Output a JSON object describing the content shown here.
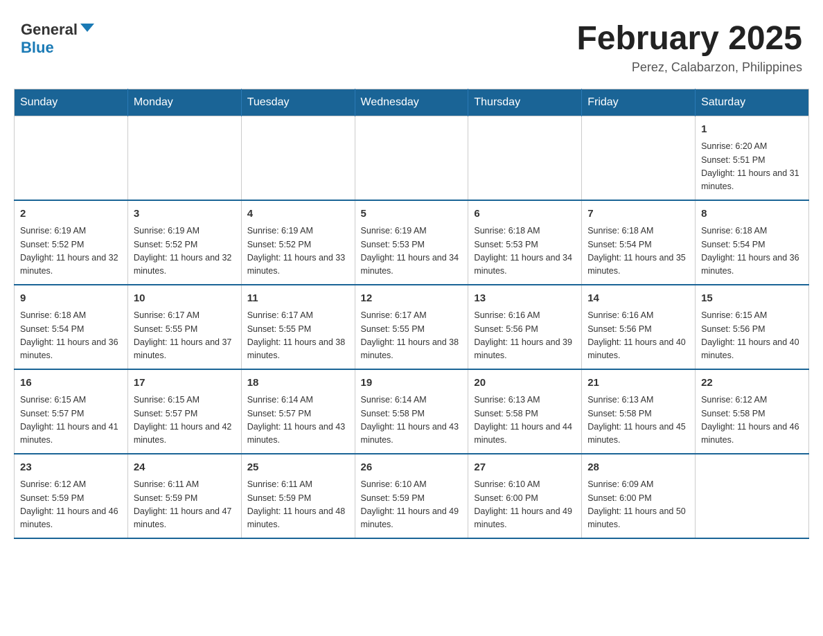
{
  "header": {
    "logo_general": "General",
    "logo_blue": "Blue",
    "month_title": "February 2025",
    "location": "Perez, Calabarzon, Philippines"
  },
  "days_of_week": [
    "Sunday",
    "Monday",
    "Tuesday",
    "Wednesday",
    "Thursday",
    "Friday",
    "Saturday"
  ],
  "weeks": [
    [
      {
        "day": "",
        "info": ""
      },
      {
        "day": "",
        "info": ""
      },
      {
        "day": "",
        "info": ""
      },
      {
        "day": "",
        "info": ""
      },
      {
        "day": "",
        "info": ""
      },
      {
        "day": "",
        "info": ""
      },
      {
        "day": "1",
        "info": "Sunrise: 6:20 AM\nSunset: 5:51 PM\nDaylight: 11 hours and 31 minutes."
      }
    ],
    [
      {
        "day": "2",
        "info": "Sunrise: 6:19 AM\nSunset: 5:52 PM\nDaylight: 11 hours and 32 minutes."
      },
      {
        "day": "3",
        "info": "Sunrise: 6:19 AM\nSunset: 5:52 PM\nDaylight: 11 hours and 32 minutes."
      },
      {
        "day": "4",
        "info": "Sunrise: 6:19 AM\nSunset: 5:52 PM\nDaylight: 11 hours and 33 minutes."
      },
      {
        "day": "5",
        "info": "Sunrise: 6:19 AM\nSunset: 5:53 PM\nDaylight: 11 hours and 34 minutes."
      },
      {
        "day": "6",
        "info": "Sunrise: 6:18 AM\nSunset: 5:53 PM\nDaylight: 11 hours and 34 minutes."
      },
      {
        "day": "7",
        "info": "Sunrise: 6:18 AM\nSunset: 5:54 PM\nDaylight: 11 hours and 35 minutes."
      },
      {
        "day": "8",
        "info": "Sunrise: 6:18 AM\nSunset: 5:54 PM\nDaylight: 11 hours and 36 minutes."
      }
    ],
    [
      {
        "day": "9",
        "info": "Sunrise: 6:18 AM\nSunset: 5:54 PM\nDaylight: 11 hours and 36 minutes."
      },
      {
        "day": "10",
        "info": "Sunrise: 6:17 AM\nSunset: 5:55 PM\nDaylight: 11 hours and 37 minutes."
      },
      {
        "day": "11",
        "info": "Sunrise: 6:17 AM\nSunset: 5:55 PM\nDaylight: 11 hours and 38 minutes."
      },
      {
        "day": "12",
        "info": "Sunrise: 6:17 AM\nSunset: 5:55 PM\nDaylight: 11 hours and 38 minutes."
      },
      {
        "day": "13",
        "info": "Sunrise: 6:16 AM\nSunset: 5:56 PM\nDaylight: 11 hours and 39 minutes."
      },
      {
        "day": "14",
        "info": "Sunrise: 6:16 AM\nSunset: 5:56 PM\nDaylight: 11 hours and 40 minutes."
      },
      {
        "day": "15",
        "info": "Sunrise: 6:15 AM\nSunset: 5:56 PM\nDaylight: 11 hours and 40 minutes."
      }
    ],
    [
      {
        "day": "16",
        "info": "Sunrise: 6:15 AM\nSunset: 5:57 PM\nDaylight: 11 hours and 41 minutes."
      },
      {
        "day": "17",
        "info": "Sunrise: 6:15 AM\nSunset: 5:57 PM\nDaylight: 11 hours and 42 minutes."
      },
      {
        "day": "18",
        "info": "Sunrise: 6:14 AM\nSunset: 5:57 PM\nDaylight: 11 hours and 43 minutes."
      },
      {
        "day": "19",
        "info": "Sunrise: 6:14 AM\nSunset: 5:58 PM\nDaylight: 11 hours and 43 minutes."
      },
      {
        "day": "20",
        "info": "Sunrise: 6:13 AM\nSunset: 5:58 PM\nDaylight: 11 hours and 44 minutes."
      },
      {
        "day": "21",
        "info": "Sunrise: 6:13 AM\nSunset: 5:58 PM\nDaylight: 11 hours and 45 minutes."
      },
      {
        "day": "22",
        "info": "Sunrise: 6:12 AM\nSunset: 5:58 PM\nDaylight: 11 hours and 46 minutes."
      }
    ],
    [
      {
        "day": "23",
        "info": "Sunrise: 6:12 AM\nSunset: 5:59 PM\nDaylight: 11 hours and 46 minutes."
      },
      {
        "day": "24",
        "info": "Sunrise: 6:11 AM\nSunset: 5:59 PM\nDaylight: 11 hours and 47 minutes."
      },
      {
        "day": "25",
        "info": "Sunrise: 6:11 AM\nSunset: 5:59 PM\nDaylight: 11 hours and 48 minutes."
      },
      {
        "day": "26",
        "info": "Sunrise: 6:10 AM\nSunset: 5:59 PM\nDaylight: 11 hours and 49 minutes."
      },
      {
        "day": "27",
        "info": "Sunrise: 6:10 AM\nSunset: 6:00 PM\nDaylight: 11 hours and 49 minutes."
      },
      {
        "day": "28",
        "info": "Sunrise: 6:09 AM\nSunset: 6:00 PM\nDaylight: 11 hours and 50 minutes."
      },
      {
        "day": "",
        "info": ""
      }
    ]
  ]
}
